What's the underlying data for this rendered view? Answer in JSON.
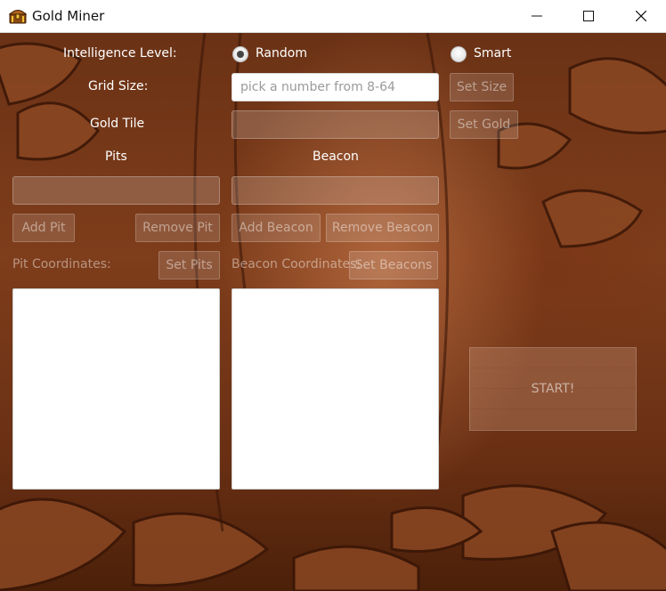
{
  "window": {
    "title": "Gold Miner"
  },
  "colors": {
    "background": "#6b3215",
    "accent": "#ffffff"
  },
  "icons": {
    "app": "treasure-chest-icon",
    "minimize": "minimize-icon",
    "maximize": "maximize-icon",
    "close": "close-icon"
  },
  "intelligence": {
    "label": "Intelligence Level:",
    "options": [
      {
        "label": "Random",
        "selected": true
      },
      {
        "label": "Smart",
        "selected": false
      }
    ]
  },
  "grid": {
    "label": "Grid Size:",
    "placeholder": "pick a number from 8-64",
    "button": "Set Size"
  },
  "gold": {
    "label": "Gold Tile",
    "button": "Set Gold"
  },
  "pits": {
    "heading": "Pits",
    "add_button": "Add Pit",
    "remove_button": "Remove Pit",
    "coords_label": "Pit Coordinates:",
    "set_button": "Set Pits"
  },
  "beacon": {
    "heading": "Beacon",
    "add_button": "Add Beacon",
    "remove_button": "Remove Beacon",
    "coords_label": "Beacon Coordinates:",
    "set_button": "Set Beacons"
  },
  "start_button": "START!"
}
